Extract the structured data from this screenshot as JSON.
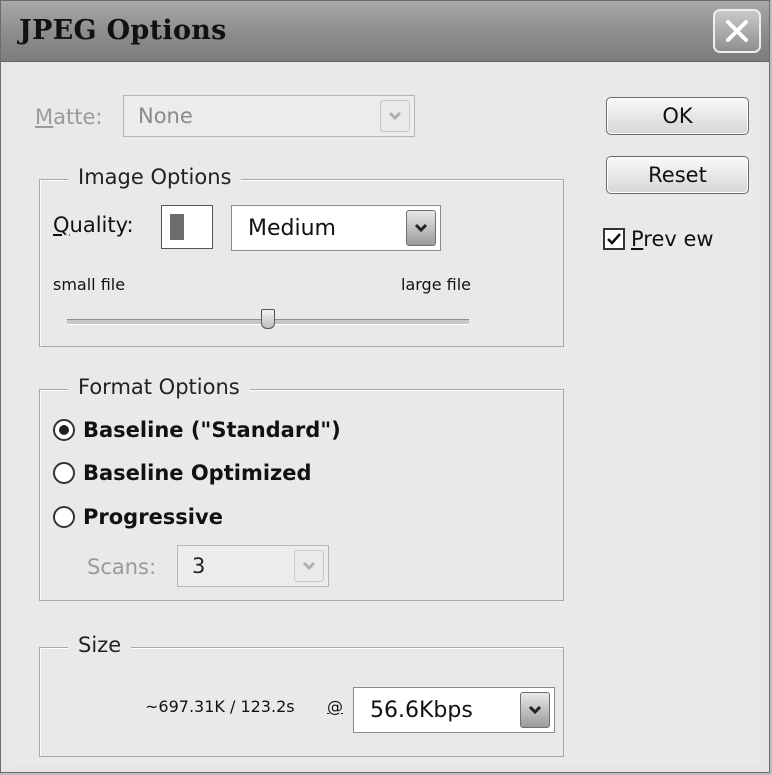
{
  "window": {
    "title": "JPEG Options"
  },
  "matte": {
    "label_prefix": "M",
    "label_rest": "atte:",
    "value": "None"
  },
  "buttons": {
    "ok": "OK",
    "reset": "Reset"
  },
  "preview": {
    "label_prefix": "P",
    "label_rest": "rev ew",
    "checked": true
  },
  "image_options": {
    "legend": "Image Options",
    "quality_label_prefix": "Q",
    "quality_label_rest": "uality:",
    "quality_preset": "Medium",
    "slider_min_label": "small file",
    "slider_max_label": "large file",
    "slider_level": 0.5
  },
  "format_options": {
    "legend": "Format Options",
    "options": [
      {
        "label": "Baseline (\"Standard\")",
        "selected": true
      },
      {
        "label": "Baseline Optimized",
        "selected": false
      },
      {
        "label": "Progressive",
        "selected": false
      }
    ],
    "scans_label": "Scans:",
    "scans_value": "3"
  },
  "size": {
    "legend": "Size",
    "estimate": "~697.31K / 123.2s",
    "at_symbol": "@",
    "speed": "56.6Kbps"
  }
}
